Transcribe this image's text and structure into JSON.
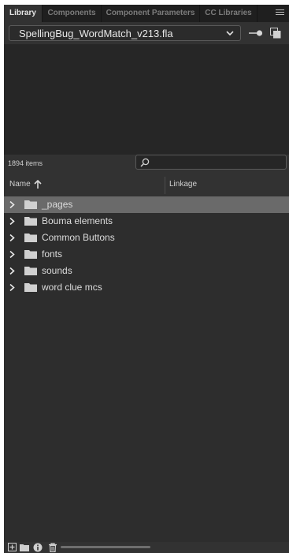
{
  "tabs": [
    {
      "label": "Library",
      "active": true
    },
    {
      "label": "Components",
      "active": false
    },
    {
      "label": "Component Parameters",
      "active": false
    },
    {
      "label": "CC Libraries",
      "active": false
    }
  ],
  "document": {
    "selected": "SpellingBug_WordMatch_v213.fla"
  },
  "library": {
    "item_count": "1894 items",
    "search_placeholder": "",
    "columns": {
      "name": "Name",
      "linkage": "Linkage"
    },
    "items": [
      {
        "label": "_pages",
        "selected": true
      },
      {
        "label": "Bouma elements",
        "selected": false
      },
      {
        "label": "Common Buttons",
        "selected": false
      },
      {
        "label": "fonts",
        "selected": false
      },
      {
        "label": "sounds",
        "selected": false
      },
      {
        "label": "word clue mcs",
        "selected": false
      }
    ]
  },
  "icons": {
    "panel_menu": "hamburger-menu-icon",
    "doc_dropdown": "chevron-down-icon",
    "pin": "pin-icon",
    "new_library_panel": "new-library-panel-icon",
    "search": "search-icon",
    "sort": "sort-ascending-icon",
    "expand": "chevron-right-icon",
    "folder": "folder-icon",
    "bottom": [
      "new-symbol-icon",
      "new-folder-icon",
      "properties-icon",
      "delete-icon"
    ]
  },
  "colors": {
    "panel_bg": "#323232",
    "selected_row": "#6a6a6a",
    "tab_active_text": "#e6e6e6"
  }
}
